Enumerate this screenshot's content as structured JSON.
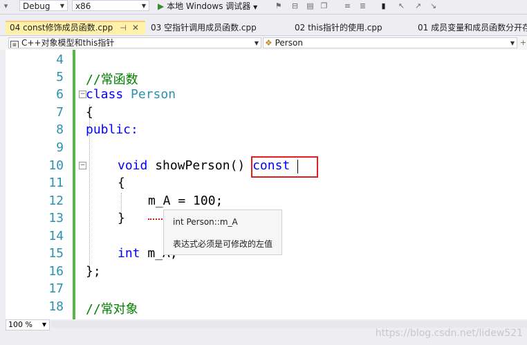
{
  "toolbar": {
    "config_value": "Debug",
    "platform_value": "x86",
    "run_label": "本地 Windows 调试器"
  },
  "tabs": [
    {
      "label": "04 const修饰成员函数.cpp",
      "active": true
    },
    {
      "label": "03 空指针调用成员函数.cpp",
      "active": false
    },
    {
      "label": "02 this指针的使用.cpp",
      "active": false
    },
    {
      "label": "01 成员变量和成员函数分开存",
      "active": false
    }
  ],
  "navbar": {
    "scope": "C++对象模型和this指针",
    "member": "Person"
  },
  "editor": {
    "line_numbers": [
      "4",
      "5",
      "6",
      "7",
      "8",
      "9",
      "10",
      "11",
      "12",
      "13",
      "14",
      "15",
      "16",
      "17",
      "18"
    ],
    "lines": {
      "l5": "//常函数",
      "l6_kw": "class",
      "l6_name": "Person",
      "l7": "{",
      "l8": "public:",
      "l10_kw": "void",
      "l10_fn": " showPerson() ",
      "l10_const": "const",
      "l11": "{",
      "l12_var": "m_A",
      "l12_rest": " = 100;",
      "l13": "}",
      "l15_kw": "int",
      "l15_rest": " m_A;",
      "l16": "};",
      "l18": "//常对象"
    }
  },
  "tooltip": {
    "title": "int Person::m_A",
    "message": "表达式必须是可修改的左值"
  },
  "statusbar": {
    "zoom": "100 %",
    "watermark": "https://blog.csdn.net/lidew521"
  }
}
